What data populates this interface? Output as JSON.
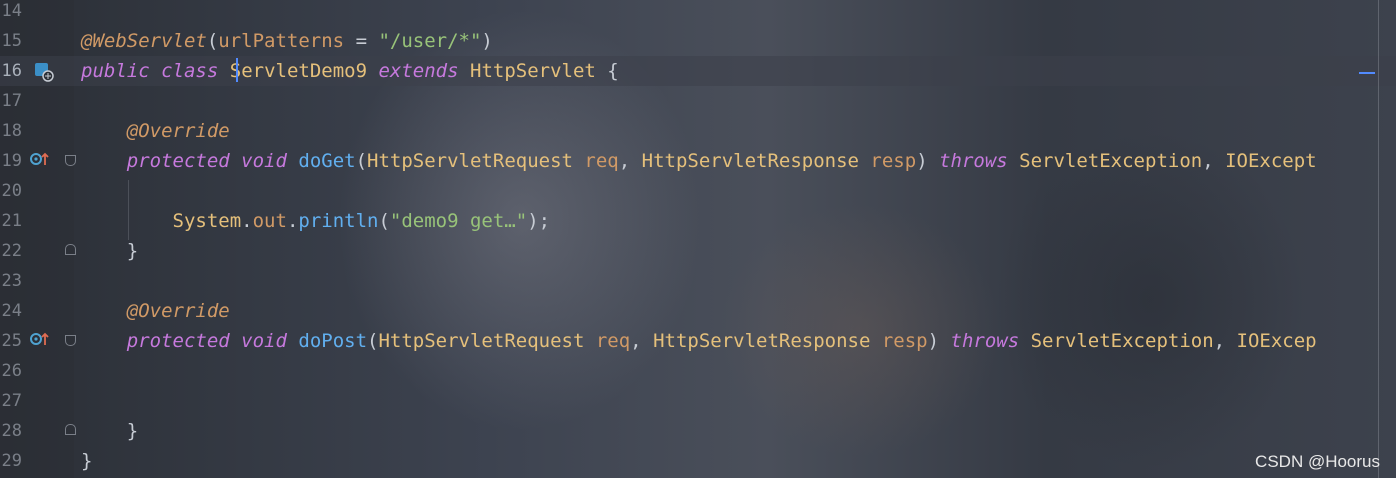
{
  "editor": {
    "lines": [
      {
        "num": "14",
        "tokens": []
      },
      {
        "num": "15",
        "tokens": [
          {
            "t": "@WebServlet",
            "c": "ann"
          },
          {
            "t": "(",
            "c": "plain"
          },
          {
            "t": "urlPatterns",
            "c": "param"
          },
          {
            "t": " = ",
            "c": "plain"
          },
          {
            "t": "\"/user/*\"",
            "c": "str"
          },
          {
            "t": ")",
            "c": "plain"
          }
        ]
      },
      {
        "num": "16",
        "current": true,
        "tokens": [
          {
            "t": "public",
            "c": "kw"
          },
          {
            "t": " ",
            "c": "plain"
          },
          {
            "t": "class",
            "c": "kw"
          },
          {
            "t": " ",
            "c": "plain"
          },
          {
            "t": "ServletDemo9",
            "c": "type"
          },
          {
            "t": " ",
            "c": "plain"
          },
          {
            "t": "extends",
            "c": "kw"
          },
          {
            "t": " ",
            "c": "plain"
          },
          {
            "t": "HttpServlet",
            "c": "type"
          },
          {
            "t": " {",
            "c": "plain"
          }
        ]
      },
      {
        "num": "17",
        "tokens": []
      },
      {
        "num": "18",
        "tokens": [
          {
            "t": "    ",
            "c": "plain"
          },
          {
            "t": "@Override",
            "c": "ann"
          }
        ]
      },
      {
        "num": "19",
        "tokens": [
          {
            "t": "    ",
            "c": "plain"
          },
          {
            "t": "protected",
            "c": "kw"
          },
          {
            "t": " ",
            "c": "plain"
          },
          {
            "t": "void",
            "c": "kw"
          },
          {
            "t": " ",
            "c": "plain"
          },
          {
            "t": "doGet",
            "c": "fn"
          },
          {
            "t": "(",
            "c": "plain"
          },
          {
            "t": "HttpServletRequest",
            "c": "type"
          },
          {
            "t": " ",
            "c": "plain"
          },
          {
            "t": "req",
            "c": "param"
          },
          {
            "t": ", ",
            "c": "plain"
          },
          {
            "t": "HttpServletResponse",
            "c": "type"
          },
          {
            "t": " ",
            "c": "plain"
          },
          {
            "t": "resp",
            "c": "param"
          },
          {
            "t": ") ",
            "c": "plain"
          },
          {
            "t": "throws",
            "c": "kw"
          },
          {
            "t": " ",
            "c": "plain"
          },
          {
            "t": "ServletException",
            "c": "type"
          },
          {
            "t": ", ",
            "c": "plain"
          },
          {
            "t": "IOExcept",
            "c": "type"
          }
        ]
      },
      {
        "num": "20",
        "tokens": []
      },
      {
        "num": "21",
        "tokens": [
          {
            "t": "        ",
            "c": "plain"
          },
          {
            "t": "System",
            "c": "type"
          },
          {
            "t": ".",
            "c": "plain"
          },
          {
            "t": "out",
            "c": "field"
          },
          {
            "t": ".",
            "c": "plain"
          },
          {
            "t": "println",
            "c": "fn"
          },
          {
            "t": "(",
            "c": "plain"
          },
          {
            "t": "\"demo9 get…\"",
            "c": "str"
          },
          {
            "t": ");",
            "c": "plain"
          }
        ]
      },
      {
        "num": "22",
        "tokens": [
          {
            "t": "    }",
            "c": "plain"
          }
        ]
      },
      {
        "num": "23",
        "tokens": []
      },
      {
        "num": "24",
        "tokens": [
          {
            "t": "    ",
            "c": "plain"
          },
          {
            "t": "@Override",
            "c": "ann"
          }
        ]
      },
      {
        "num": "25",
        "tokens": [
          {
            "t": "    ",
            "c": "plain"
          },
          {
            "t": "protected",
            "c": "kw"
          },
          {
            "t": " ",
            "c": "plain"
          },
          {
            "t": "void",
            "c": "kw"
          },
          {
            "t": " ",
            "c": "plain"
          },
          {
            "t": "doPost",
            "c": "fn"
          },
          {
            "t": "(",
            "c": "plain"
          },
          {
            "t": "HttpServletRequest",
            "c": "type"
          },
          {
            "t": " ",
            "c": "plain"
          },
          {
            "t": "req",
            "c": "param"
          },
          {
            "t": ", ",
            "c": "plain"
          },
          {
            "t": "HttpServletResponse",
            "c": "type"
          },
          {
            "t": " ",
            "c": "plain"
          },
          {
            "t": "resp",
            "c": "param"
          },
          {
            "t": ") ",
            "c": "plain"
          },
          {
            "t": "throws",
            "c": "kw"
          },
          {
            "t": " ",
            "c": "plain"
          },
          {
            "t": "ServletException",
            "c": "type"
          },
          {
            "t": ", ",
            "c": "plain"
          },
          {
            "t": "IOExcep",
            "c": "type"
          }
        ]
      },
      {
        "num": "26",
        "tokens": []
      },
      {
        "num": "27",
        "tokens": []
      },
      {
        "num": "28",
        "tokens": [
          {
            "t": "    }",
            "c": "plain"
          }
        ]
      },
      {
        "num": "29",
        "tokens": [
          {
            "t": "}",
            "c": "plain"
          }
        ]
      }
    ]
  },
  "colors": {
    "keyword": "#c679dd",
    "annotation": "#d19a66",
    "type": "#e5c07b",
    "string": "#98c379",
    "function": "#61afef",
    "caret": "#528bff"
  },
  "watermark": "CSDN @Hoorus"
}
